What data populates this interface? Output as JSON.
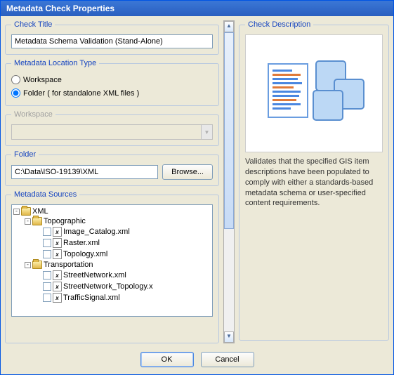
{
  "window": {
    "title": "Metadata Check Properties"
  },
  "check_title": {
    "legend": "Check Title",
    "value": "Metadata Schema Validation (Stand-Alone)"
  },
  "location_type": {
    "legend": "Metadata Location Type",
    "workspace": "Workspace",
    "folder": "Folder ( for standalone XML files )",
    "selected": "folder"
  },
  "workspace": {
    "legend": "Workspace",
    "value": ""
  },
  "folder": {
    "legend": "Folder",
    "path": "C:\\Data\\ISO-19139\\XML",
    "browse": "Browse..."
  },
  "sources": {
    "legend": "Metadata Sources",
    "root": "XML",
    "groups": [
      {
        "name": "Topographic",
        "files": [
          "Image_Catalog.xml",
          "Raster.xml",
          "Topology.xml"
        ]
      },
      {
        "name": "Transportation",
        "files": [
          "StreetNetwork.xml",
          "StreetNetwork_Topology.x",
          "TrafficSignal.xml"
        ]
      }
    ]
  },
  "description": {
    "legend": "Check Description",
    "text": "Validates that the specified GIS item descriptions have been populated to comply with either a standards-based metadata schema or user-specified content requirements."
  },
  "buttons": {
    "ok": "OK",
    "cancel": "Cancel"
  }
}
